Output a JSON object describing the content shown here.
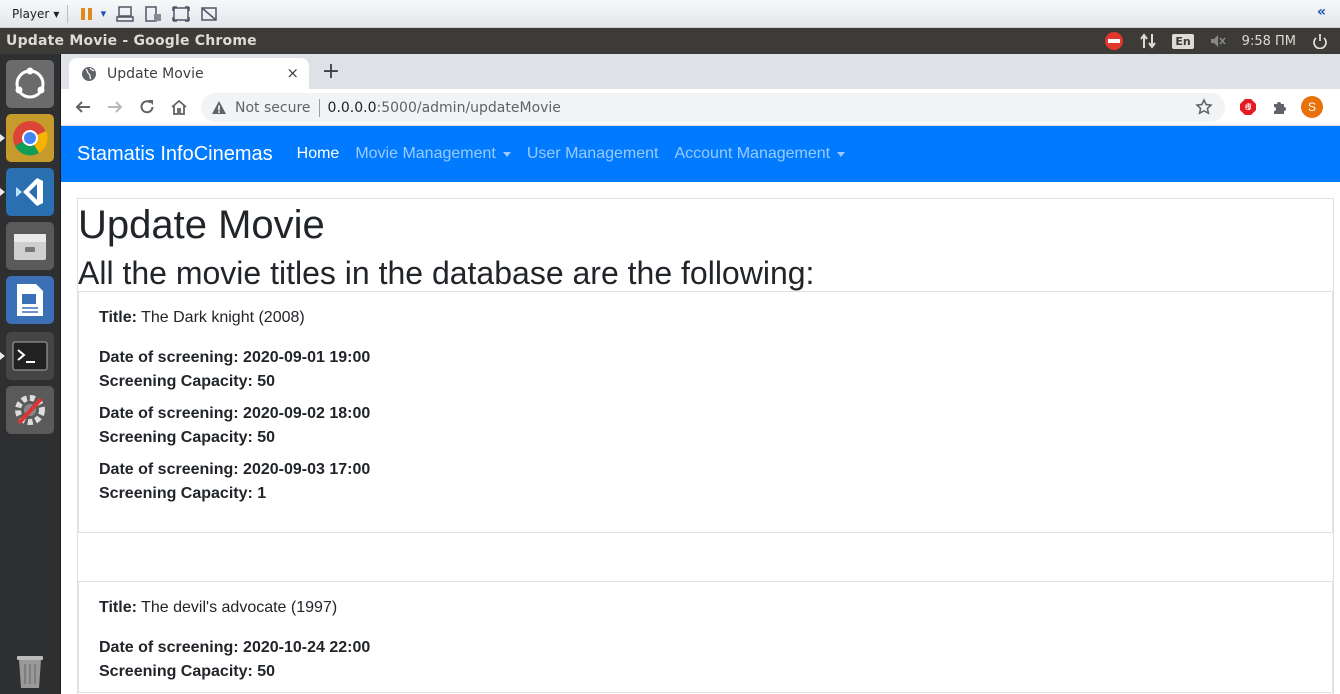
{
  "vm_toolbar": {
    "player_label": "Player"
  },
  "os_panel": {
    "window_title": "Update Movie - Google Chrome",
    "lang": "En",
    "clock": "9:58 ΠΜ"
  },
  "browser": {
    "tab_title": "Update Movie",
    "new_tab": "+",
    "tab_close": "×",
    "not_secure": "Not secure",
    "url_host": "0.0.0.0",
    "url_path": ":5000/admin/updateMovie",
    "avatar_letter": "S"
  },
  "site_nav": {
    "brand": "Stamatis InfoCinemas",
    "home": "Home",
    "movie_management": "Movie Management",
    "user_management": "User Management",
    "account_management": "Account Management"
  },
  "page": {
    "heading": "Update Movie",
    "subheading": "All the movie titles in the database are the following:",
    "title_label": "Title:",
    "date_label": "Date of screening:",
    "capacity_label": "Screening Capacity:"
  },
  "movies": [
    {
      "title": "The Dark knight (2008)",
      "screenings": [
        {
          "date": "2020-09-01 19:00",
          "capacity": "50"
        },
        {
          "date": "2020-09-02 18:00",
          "capacity": "50"
        },
        {
          "date": "2020-09-03 17:00",
          "capacity": "1"
        }
      ]
    },
    {
      "title": "The devil's advocate (1997)",
      "screenings": [
        {
          "date": "2020-10-24 22:00",
          "capacity": "50"
        }
      ]
    }
  ],
  "colors": {
    "navbar": "#007bff",
    "ubuntu_panel": "#3c3b37",
    "launcher": "#2e2f31"
  }
}
